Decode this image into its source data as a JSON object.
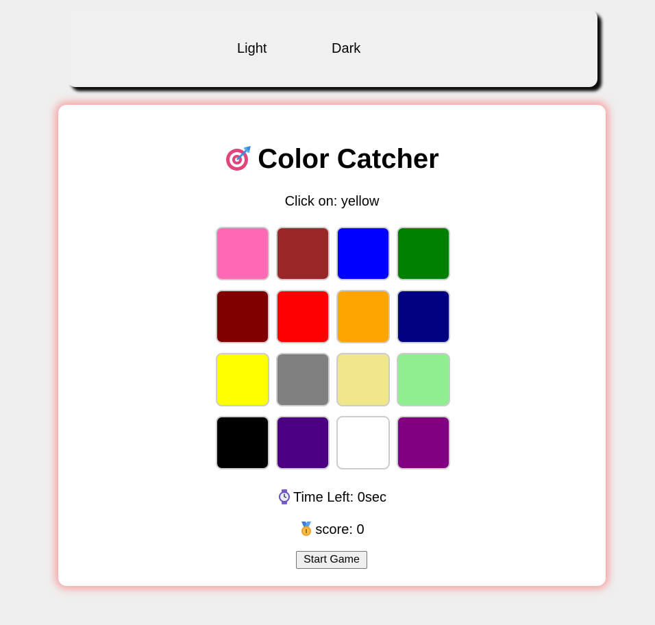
{
  "theme_switcher": {
    "light_label": "Light",
    "dark_label": "Dark"
  },
  "game": {
    "title": "Color Catcher",
    "title_icon": "target-dart-icon",
    "prompt": "Click on: yellow",
    "time_icon": "stopwatch-icon",
    "time_text": "Time Left: 0sec",
    "score_icon": "medal-icon",
    "score_text": "score: 0",
    "start_label": "Start Game",
    "accent_glow": "#ff5a5a"
  },
  "color_grid": [
    {
      "color": "#ff69b4"
    },
    {
      "color": "#9b2828"
    },
    {
      "color": "#0000ff"
    },
    {
      "color": "#008000"
    },
    {
      "color": "#800000"
    },
    {
      "color": "#ff0000"
    },
    {
      "color": "#ffa500"
    },
    {
      "color": "#000080"
    },
    {
      "color": "#ffff00"
    },
    {
      "color": "#808080"
    },
    {
      "color": "#f0e68c"
    },
    {
      "color": "#90ee90"
    },
    {
      "color": "#000000"
    },
    {
      "color": "#4b0082"
    },
    {
      "color": "#ffffff"
    },
    {
      "color": "#800080"
    }
  ]
}
